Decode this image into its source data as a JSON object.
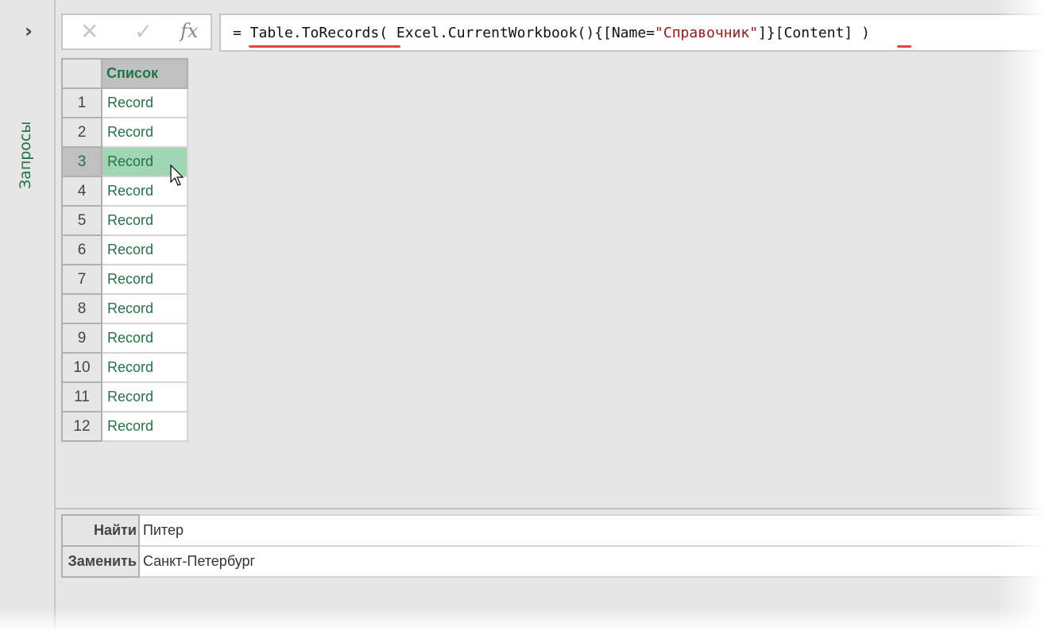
{
  "sidebar": {
    "expand_icon": "chevron-right-icon",
    "label": "Запросы"
  },
  "formula_buttons": {
    "cancel": "✕",
    "confirm": "✓",
    "fx": "fx"
  },
  "formula": {
    "prefix": "= Table.ToRecords( Excel.CurrentWorkbook(){[Name=",
    "string": "\"Справочник\"",
    "suffix": "]}[Content] )"
  },
  "grid": {
    "column_header": "Список",
    "rows": [
      {
        "num": "1",
        "value": "Record"
      },
      {
        "num": "2",
        "value": "Record"
      },
      {
        "num": "3",
        "value": "Record"
      },
      {
        "num": "4",
        "value": "Record"
      },
      {
        "num": "5",
        "value": "Record"
      },
      {
        "num": "6",
        "value": "Record"
      },
      {
        "num": "7",
        "value": "Record"
      },
      {
        "num": "8",
        "value": "Record"
      },
      {
        "num": "9",
        "value": "Record"
      },
      {
        "num": "10",
        "value": "Record"
      },
      {
        "num": "11",
        "value": "Record"
      },
      {
        "num": "12",
        "value": "Record"
      }
    ],
    "selected_row": 3
  },
  "find_replace": {
    "find_label": "Найти",
    "find_value": "Питер",
    "replace_label": "Заменить",
    "replace_value": "Санкт-Петербург"
  }
}
